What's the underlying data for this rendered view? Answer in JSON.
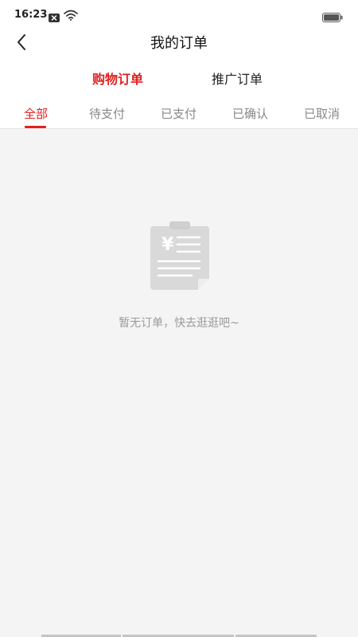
{
  "status_bar": {
    "time": "16:23",
    "icons": [
      "close-box-icon",
      "wifi-icon",
      "battery-icon"
    ]
  },
  "header": {
    "title": "我的订单",
    "back_icon": "chevron-left-icon"
  },
  "order_type_tabs": [
    {
      "label": "购物订单",
      "active": true
    },
    {
      "label": "推广订单",
      "active": false
    }
  ],
  "status_tabs": [
    {
      "label": "全部",
      "active": true
    },
    {
      "label": "待支付",
      "active": false
    },
    {
      "label": "已支付",
      "active": false
    },
    {
      "label": "已确认",
      "active": false
    },
    {
      "label": "已取消",
      "active": false
    }
  ],
  "empty_state": {
    "icon": "empty-order-clipboard-icon",
    "text": "暂无订单，快去逛逛吧~"
  },
  "colors": {
    "accent": "#e02020",
    "background": "#f4f4f4",
    "muted_text": "#9a9a9a"
  }
}
